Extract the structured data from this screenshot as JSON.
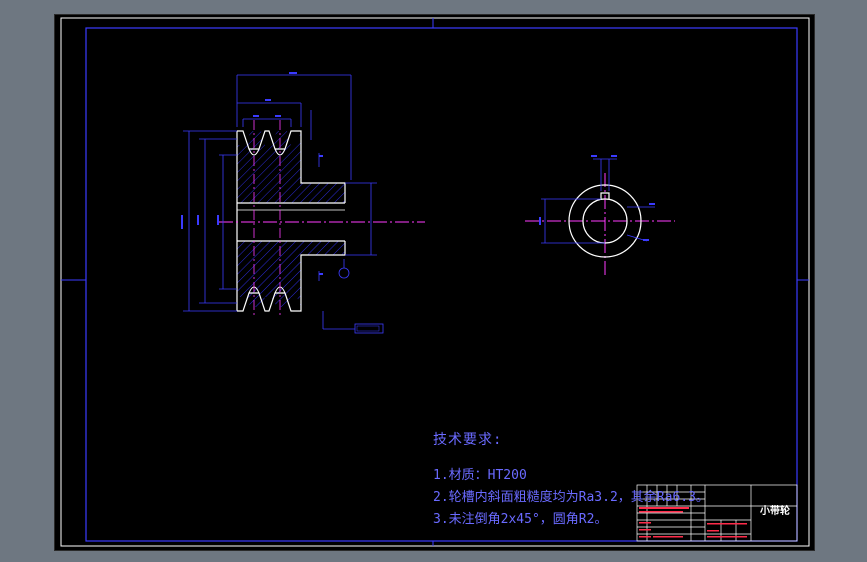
{
  "drawing": {
    "title_block": {
      "part_name": "小带轮"
    },
    "technical_requirements": {
      "title": "技术要求:",
      "items": [
        "1.材质：HT200",
        "2.轮槽内斜面粗糙度均为Ra3.2，其余Ra6.3。",
        "3.未注倒角2x45°，圆角R2。"
      ]
    }
  },
  "colors": {
    "background": "#000000",
    "frame": "#3b3bff",
    "part_outline": "#ffffff",
    "hatch": "#2b2bd8",
    "dimension": "#3b3bff",
    "centerline": "#ff3bff",
    "notes_text": "#6a6aff",
    "title_block_red": "#ff2b4a"
  }
}
